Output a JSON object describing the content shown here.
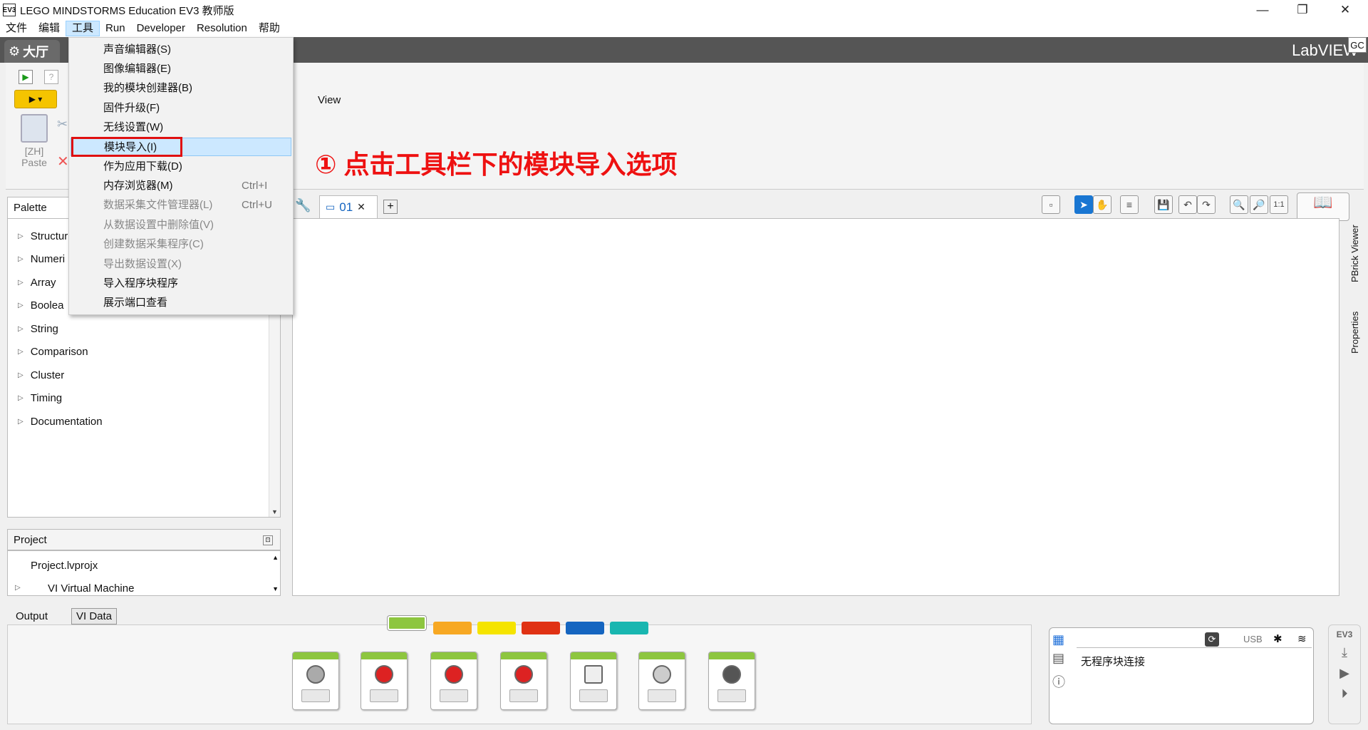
{
  "window": {
    "title": "LEGO MINDSTORMS Education EV3 教师版",
    "app_icon": "EV3"
  },
  "menubar": [
    "文件",
    "编辑",
    "工具",
    "Run",
    "Developer",
    "Resolution",
    "帮助"
  ],
  "menubar_active": "工具",
  "lobby_tab": "大厅",
  "labview_brand": "LabVIEW",
  "gc_badge": "GC",
  "ribbon": {
    "view_label": "View",
    "paste_label": "[ZH]\nPaste",
    "paste_line1": "[ZH]",
    "paste_line2": "Paste"
  },
  "tools_menu": [
    {
      "label": "声音编辑器(S)",
      "shortcut": "",
      "disabled": false
    },
    {
      "label": "图像编辑器(E)",
      "shortcut": "",
      "disabled": false
    },
    {
      "label": "我的模块创建器(B)",
      "shortcut": "",
      "disabled": false
    },
    {
      "label": "固件升级(F)",
      "shortcut": "",
      "disabled": false
    },
    {
      "label": "无线设置(W)",
      "shortcut": "",
      "disabled": false
    },
    {
      "label": "模块导入(I)",
      "shortcut": "",
      "disabled": false,
      "highlighted": true
    },
    {
      "label": "作为应用下载(D)",
      "shortcut": "",
      "disabled": false
    },
    {
      "label": "内存浏览器(M)",
      "shortcut": "Ctrl+I",
      "disabled": false
    },
    {
      "label": "数据采集文件管理器(L)",
      "shortcut": "Ctrl+U",
      "disabled": true
    },
    {
      "label": "从数据设置中删除值(V)",
      "shortcut": "",
      "disabled": true
    },
    {
      "label": "创建数据采集程序(C)",
      "shortcut": "",
      "disabled": true
    },
    {
      "label": "导出数据设置(X)",
      "shortcut": "",
      "disabled": true
    },
    {
      "label": "导入程序块程序",
      "shortcut": "",
      "disabled": false
    },
    {
      "label": "展示端口查看",
      "shortcut": "",
      "disabled": false
    }
  ],
  "annotation": "① 点击工具栏下的模块导入选项",
  "palette": {
    "title": "Palette",
    "items": [
      "Structur",
      "Numeri",
      "Array",
      "Boolea",
      "String",
      "Comparison",
      "Cluster",
      "Timing",
      "Documentation"
    ]
  },
  "project": {
    "title": "Project",
    "items": [
      "Project.lvprojx",
      "VI Virtual Machine"
    ]
  },
  "doc_tab": {
    "label": "01",
    "close": "✕",
    "add": "+"
  },
  "right_panels": [
    "PBrick Viewer",
    "Properties"
  ],
  "bottom_tabs": [
    "Output",
    "VI Data"
  ],
  "palette_colors": [
    "#8dc63f",
    "#f7a823",
    "#f5e400",
    "#e03214",
    "#1565c0",
    "#19b6b0"
  ],
  "brick": {
    "status": "无程序块连接",
    "usb": "USB",
    "brick_label": "EV3"
  },
  "toolbar_labels": {
    "zoom_1_1": "1:1"
  }
}
